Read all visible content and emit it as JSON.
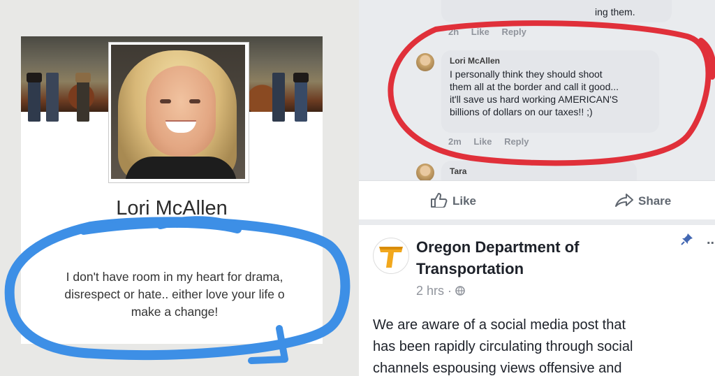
{
  "left_panel": {
    "profile_name": "Lori McAllen",
    "bio": "I don't have room in my heart for drama,\ndisrespect or hate.. either love your life o\nmake a change!",
    "annotation_color": "#3d8fe6"
  },
  "right_panel": {
    "comment_above": {
      "text": "ing them.",
      "time": "2h",
      "like_label": "Like",
      "reply_label": "Reply"
    },
    "comment": {
      "author": "Lori McAllen",
      "text": "I personally think they should shoot\nthem all at the border and call it good...\nit'll save us hard working AMERICAN'S\nbillions of dollars on our taxes!! ;)",
      "time": "2m",
      "like_label": "Like",
      "reply_label": "Reply"
    },
    "next_comment_author": "Tara",
    "actions": {
      "like_label": "Like",
      "share_label": "Share"
    },
    "post": {
      "page_name": "Oregon Department of Transportation",
      "timestamp": "2 hrs",
      "text": "We are aware of a social media post that\nhas been rapidly circulating through social\nchannels espousing views offensive and",
      "more_menu": "..."
    },
    "annotation_color": "#e0303a"
  }
}
